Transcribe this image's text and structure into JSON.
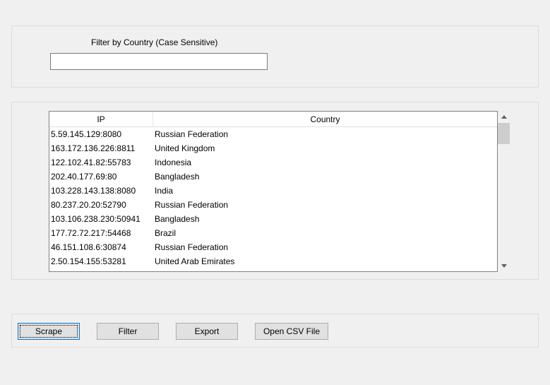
{
  "filter": {
    "label": "Filter by Country (Case Sensitive)",
    "value": "",
    "placeholder": ""
  },
  "table": {
    "columns": {
      "ip": "IP",
      "country": "Country"
    },
    "rows": [
      {
        "ip": "5.59.145.129:8080",
        "country": "Russian Federation"
      },
      {
        "ip": "163.172.136.226:8811",
        "country": "United Kingdom"
      },
      {
        "ip": "122.102.41.82:55783",
        "country": "Indonesia"
      },
      {
        "ip": "202.40.177.69:80",
        "country": "Bangladesh"
      },
      {
        "ip": "103.228.143.138:8080",
        "country": "India"
      },
      {
        "ip": "80.237.20.20:52790",
        "country": "Russian Federation"
      },
      {
        "ip": "103.106.238.230:50941",
        "country": "Bangladesh"
      },
      {
        "ip": "177.72.72.217:54468",
        "country": "Brazil"
      },
      {
        "ip": "46.151.108.6:30874",
        "country": "Russian Federation"
      },
      {
        "ip": "2.50.154.155:53281",
        "country": "United Arab Emirates"
      }
    ]
  },
  "buttons": {
    "scrape": "Scrape",
    "filter": "Filter",
    "export": "Export",
    "open_csv": "Open CSV File"
  }
}
